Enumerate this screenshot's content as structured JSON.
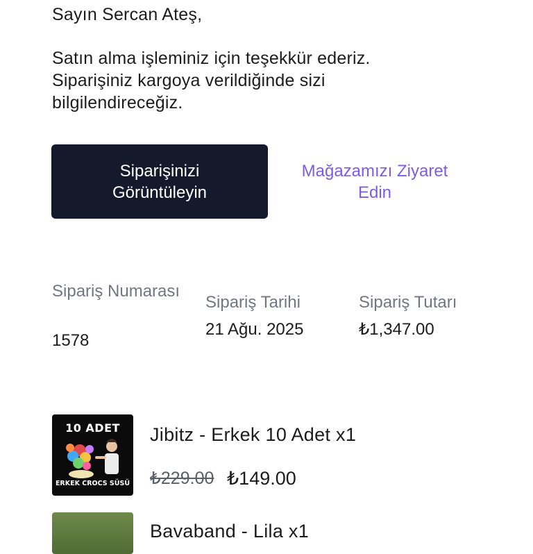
{
  "greeting": "Sayın Sercan Ateş,",
  "message_lines": [
    "Satın alma işleminiz için teşekkür ederiz.",
    "Siparişiniz kargoya verildiğinde sizi",
    "bilgilendireceğiz."
  ],
  "buttons": {
    "view_order": "Siparişinizi Görüntüleyin",
    "visit_store": "Mağazamızı Ziyaret Edin"
  },
  "order_info": {
    "number_label": "Sipariş Numarası",
    "number_value": "1578",
    "date_label": "Sipariş Tarihi",
    "date_value": "21 Ağu. 2025",
    "total_label": "Sipariş Tutarı",
    "total_value": "₺1,347.00"
  },
  "products": [
    {
      "name": "Jibitz - Erkek 10 Adet x1",
      "old_price": "₺229.00",
      "new_price": "₺149.00",
      "image_text_top": "10 ADET",
      "image_text_bottom": "ERKEK CROCS SÜSÜ"
    },
    {
      "name": "Bavaband - Lila x1"
    }
  ],
  "colors": {
    "primary_button": "#141a2b",
    "link": "#7c5ce6",
    "label": "#707682"
  }
}
